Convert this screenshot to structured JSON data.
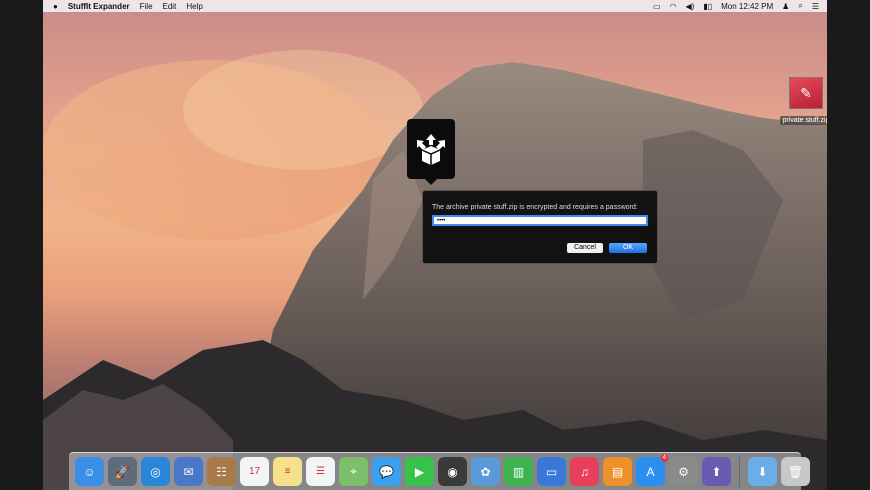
{
  "menubar": {
    "apple": "",
    "app_name": "StuffIt Expander",
    "menus": [
      "File",
      "Edit",
      "Help"
    ],
    "clock": "Mon 12:42 PM"
  },
  "desktop_icon": {
    "label": "private stuff.zip"
  },
  "dialog": {
    "message": "The archive private stuff.zip is encrypted and requires a password:",
    "password_value": "••••",
    "cancel_label": "Cancel",
    "ok_label": "OK"
  },
  "dock": {
    "items": [
      {
        "name": "finder",
        "glyph": "☺",
        "color": "#3a8ee6"
      },
      {
        "name": "launchpad",
        "glyph": "🚀",
        "color": "#5d6b7a"
      },
      {
        "name": "safari",
        "glyph": "◎",
        "color": "#2b86d9"
      },
      {
        "name": "mail",
        "glyph": "✉",
        "color": "#4a78c8"
      },
      {
        "name": "contacts",
        "glyph": "☷",
        "color": "#a87a4a"
      },
      {
        "name": "calendar",
        "glyph": "17",
        "color": "#f4f4f4"
      },
      {
        "name": "notes",
        "glyph": "≡",
        "color": "#f6e08a"
      },
      {
        "name": "reminders",
        "glyph": "☰",
        "color": "#f4f4f4"
      },
      {
        "name": "maps",
        "glyph": "⌖",
        "color": "#7bbf6a"
      },
      {
        "name": "messages",
        "glyph": "💬",
        "color": "#3aa0f0"
      },
      {
        "name": "facetime",
        "glyph": "▶",
        "color": "#37c24a"
      },
      {
        "name": "photo-booth",
        "glyph": "◉",
        "color": "#3a3a3a"
      },
      {
        "name": "iphoto",
        "glyph": "✿",
        "color": "#5a9ad8"
      },
      {
        "name": "numbers",
        "glyph": "▥",
        "color": "#3fb34f"
      },
      {
        "name": "keynote",
        "glyph": "▭",
        "color": "#3a78d8"
      },
      {
        "name": "itunes",
        "glyph": "♫",
        "color": "#e8405a"
      },
      {
        "name": "ibooks",
        "glyph": "▤",
        "color": "#f0902a"
      },
      {
        "name": "app-store",
        "glyph": "A",
        "color": "#2b8ff0",
        "badge": "4"
      },
      {
        "name": "system-preferences",
        "glyph": "⚙",
        "color": "#8a8a8a"
      },
      {
        "name": "stuffit-expander",
        "glyph": "⬆",
        "color": "#6a5ab0"
      }
    ],
    "right_items": [
      {
        "name": "downloads-folder",
        "glyph": "⬇",
        "color": "#6aaee8"
      },
      {
        "name": "trash",
        "glyph": "🗑",
        "color": "#c8c8c8"
      }
    ]
  }
}
